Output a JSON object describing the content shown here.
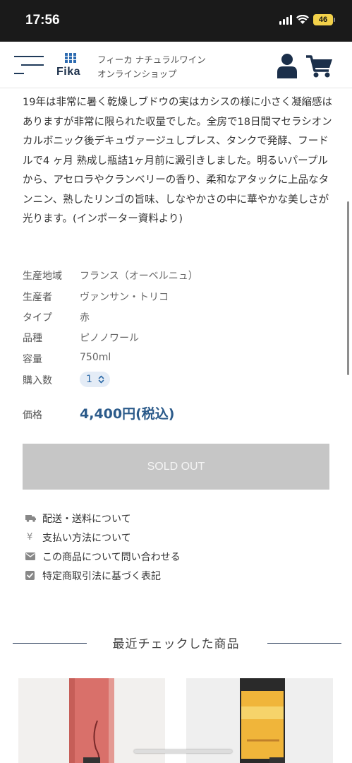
{
  "status": {
    "time": "17:56",
    "battery": "46"
  },
  "header": {
    "logo_text": "Fika",
    "tagline_line1": "フィーカ ナチュラルワイン",
    "tagline_line2": "オンラインショップ"
  },
  "description": "19年は非常に暑く乾燥しブドウの実はカシスの様に小さく凝縮感はありますが非常に限られた収量でした。全房で18日間マセラシオンカルボニック後デキュヴァージュしプレス、タンクで発酵、フードルで4 ヶ月 熟成し瓶詰1ヶ月前に澱引きしました。明るいパープルから、アセロラやクランベリーの香り、柔和なアタックに上品なタンニン、熟したリンゴの旨味、しなやかさの中に華やかな美しさが光ります。(インポーター資料より)",
  "specs": [
    {
      "label": "生産地域",
      "value": "フランス（オーベルニュ）"
    },
    {
      "label": "生産者",
      "value": "ヴァンサン・トリコ"
    },
    {
      "label": "タイプ",
      "value": "赤"
    },
    {
      "label": "品種",
      "value": "ピノノワール"
    },
    {
      "label": "容量",
      "value": "750ml"
    }
  ],
  "quantity": {
    "label": "購入数",
    "value": "1"
  },
  "price": {
    "label": "価格",
    "value": "4,400円(税込)"
  },
  "soldout_label": "SOLD OUT",
  "links": [
    {
      "label": "配送・送料について",
      "icon": "truck-icon"
    },
    {
      "label": "支払い方法について",
      "icon": "yen-icon"
    },
    {
      "label": "この商品について問い合わせる",
      "icon": "mail-icon"
    },
    {
      "label": "特定商取引法に基づく表記",
      "icon": "check-icon"
    }
  ],
  "recent": {
    "title": "最近チェックした商品"
  },
  "colors": {
    "accent": "#2b5a8a",
    "navy": "#1f3a5a",
    "soldout": "#c6c6c6"
  }
}
